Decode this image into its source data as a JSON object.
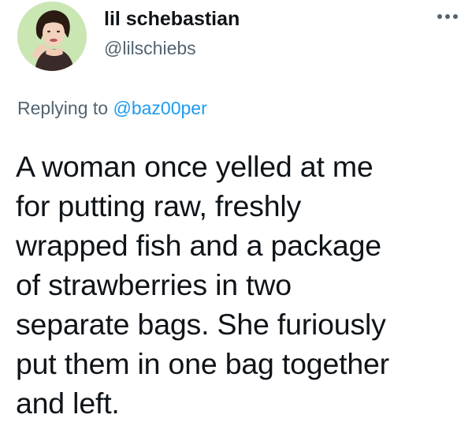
{
  "author": {
    "display_name": "lil schebastian",
    "handle": "@lilschiebs",
    "avatar_icon": "profile-photo"
  },
  "more_icon": "more-horizontal-icon",
  "reply": {
    "prefix": "Replying to",
    "mention": "@baz00per"
  },
  "tweet": {
    "lines": [
      "A woman once yelled at me",
      "for putting raw, freshly",
      "wrapped fish and a package",
      "of strawberries in two",
      "separate bags. She furiously",
      "put them in one bag together",
      "and left."
    ]
  },
  "colors": {
    "text": "#0f1419",
    "secondary": "#536471",
    "link": "#1d9bf0",
    "avatar_bg": "#c8e4b0"
  }
}
